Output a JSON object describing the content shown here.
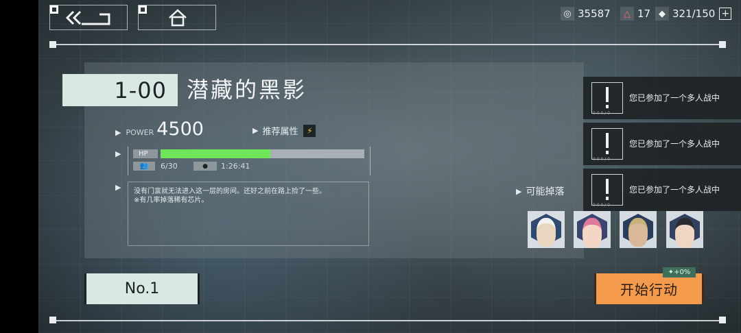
{
  "header": {
    "resources": [
      {
        "icon": "gem-icon",
        "value": "35587"
      },
      {
        "icon": "warning-triangle-icon",
        "value": "17"
      },
      {
        "icon": "stamina-icon",
        "value": "321/150"
      }
    ],
    "add_symbol": "+"
  },
  "stage": {
    "id": "1-00",
    "name": "潜藏的黑影",
    "power_label": "POWER",
    "power_value": "4500",
    "recommended_label": "推荐属性",
    "hp_label": "HP",
    "hp_fraction": 0.54,
    "players": "6/30",
    "time": "1:26:41",
    "description_line1": "没有门禀就无法进入这一层的房间。还好之前在路上捡了一些。",
    "description_line2": "※有几率掉落稀有芯片。"
  },
  "drops": {
    "label": "可能掉落",
    "items": [
      "avatar-old-sage",
      "avatar-pink-hair",
      "avatar-armored-soldier",
      "avatar-dark-hair"
    ]
  },
  "notifications": [
    {
      "text": "您已参加了一个多人战中",
      "sub": "0 0 0 / 0"
    },
    {
      "text": "您已参加了一个多人战中",
      "sub": "0 0 0 / 0"
    },
    {
      "text": "您已参加了一个多人战中",
      "sub": "0 0 0 / 0"
    }
  ],
  "buttons": {
    "rank_label": "No.1",
    "start_label": "开始行动",
    "bonus_label": "+0%"
  },
  "colors": {
    "accent_orange": "#f39a4c",
    "mint": "#d9e8e2",
    "hp_green": "#6fe65a"
  }
}
